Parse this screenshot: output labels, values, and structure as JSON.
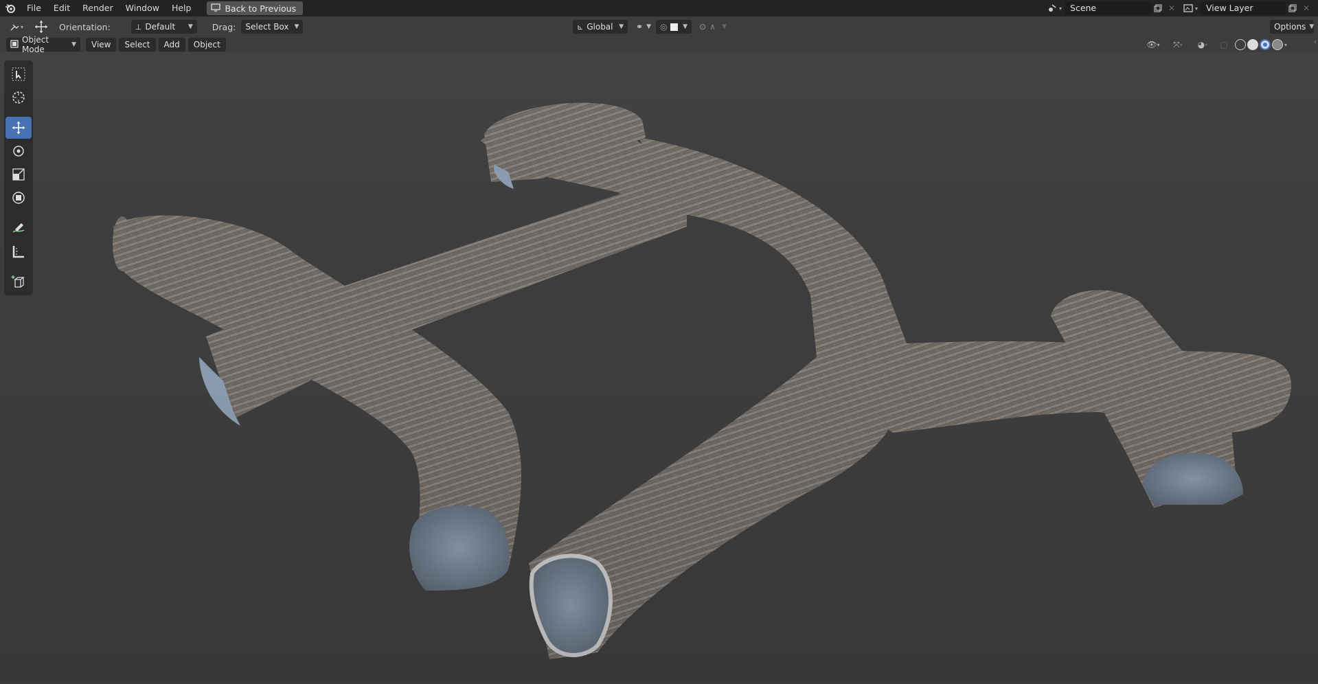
{
  "topbar": {
    "menus": [
      "File",
      "Edit",
      "Render",
      "Window",
      "Help"
    ],
    "back_label": "Back to Previous",
    "scene_value": "Scene",
    "view_layer_value": "View Layer"
  },
  "tool_settings": {
    "orientation_label": "Orientation:",
    "orientation_value": "Default",
    "drag_label": "Drag:",
    "drag_value": "Select Box",
    "transform_orientation": "Global",
    "options_label": "Options"
  },
  "viewport_header": {
    "mode": "Object Mode",
    "menus": [
      "View",
      "Select",
      "Add",
      "Object"
    ]
  },
  "toolbar": {
    "tools": [
      "select-box",
      "cursor",
      "move",
      "rotate",
      "scale",
      "transform",
      "annotate",
      "measure",
      "add-cube"
    ],
    "active": "move"
  },
  "colors": {
    "accent": "#4772b3",
    "background": "#3d3d3d",
    "topbar": "#232323"
  }
}
